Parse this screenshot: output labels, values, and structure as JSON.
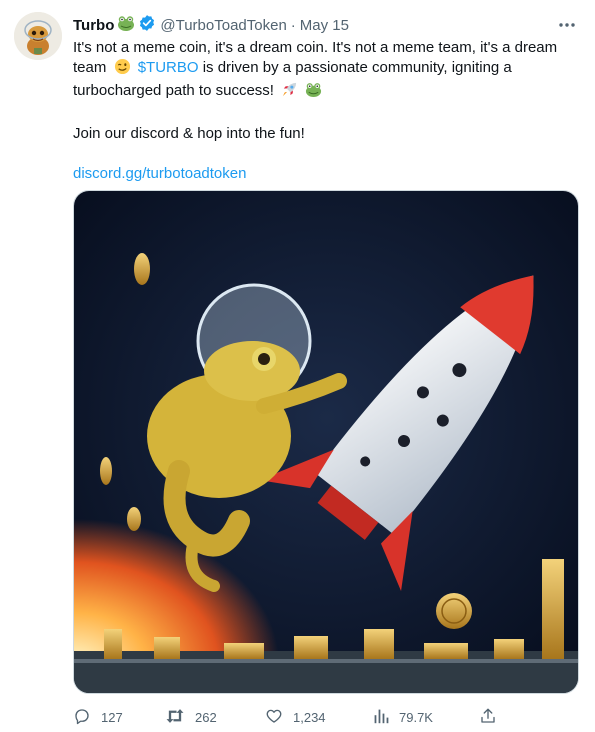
{
  "tweet": {
    "display_name": "Turbo",
    "name_emoji": "🐸",
    "handle": "@TurboToadToken",
    "separator": "·",
    "date": "May 15",
    "text": {
      "line1": "It's not a meme coin, it's a dream coin. It's not a meme team, it's a dream",
      "line2_start": "team",
      "wink_emoji": "😉",
      "cashtag": "$TURBO",
      "line2_end": "is driven by a passionate community, igniting a",
      "line3": "turbocharged path to success!",
      "rocket_emoji": "🚀",
      "frog_emoji": "🐸",
      "paragraph2": "Join our discord & hop into the fun!",
      "link": "discord.gg/turbotoadtoken"
    },
    "actions": {
      "replies": "127",
      "retweets": "262",
      "likes": "1,234",
      "views": "79.7K"
    }
  },
  "colors": {
    "text_primary": "#0f1419",
    "text_secondary": "#536471",
    "link": "#1d9bf0",
    "verified": "#1d9bf0",
    "border": "#cfd9de"
  },
  "icons": [
    "verified-badge-icon",
    "more-icon",
    "reply-icon",
    "retweet-icon",
    "like-icon",
    "views-icon",
    "share-icon"
  ]
}
